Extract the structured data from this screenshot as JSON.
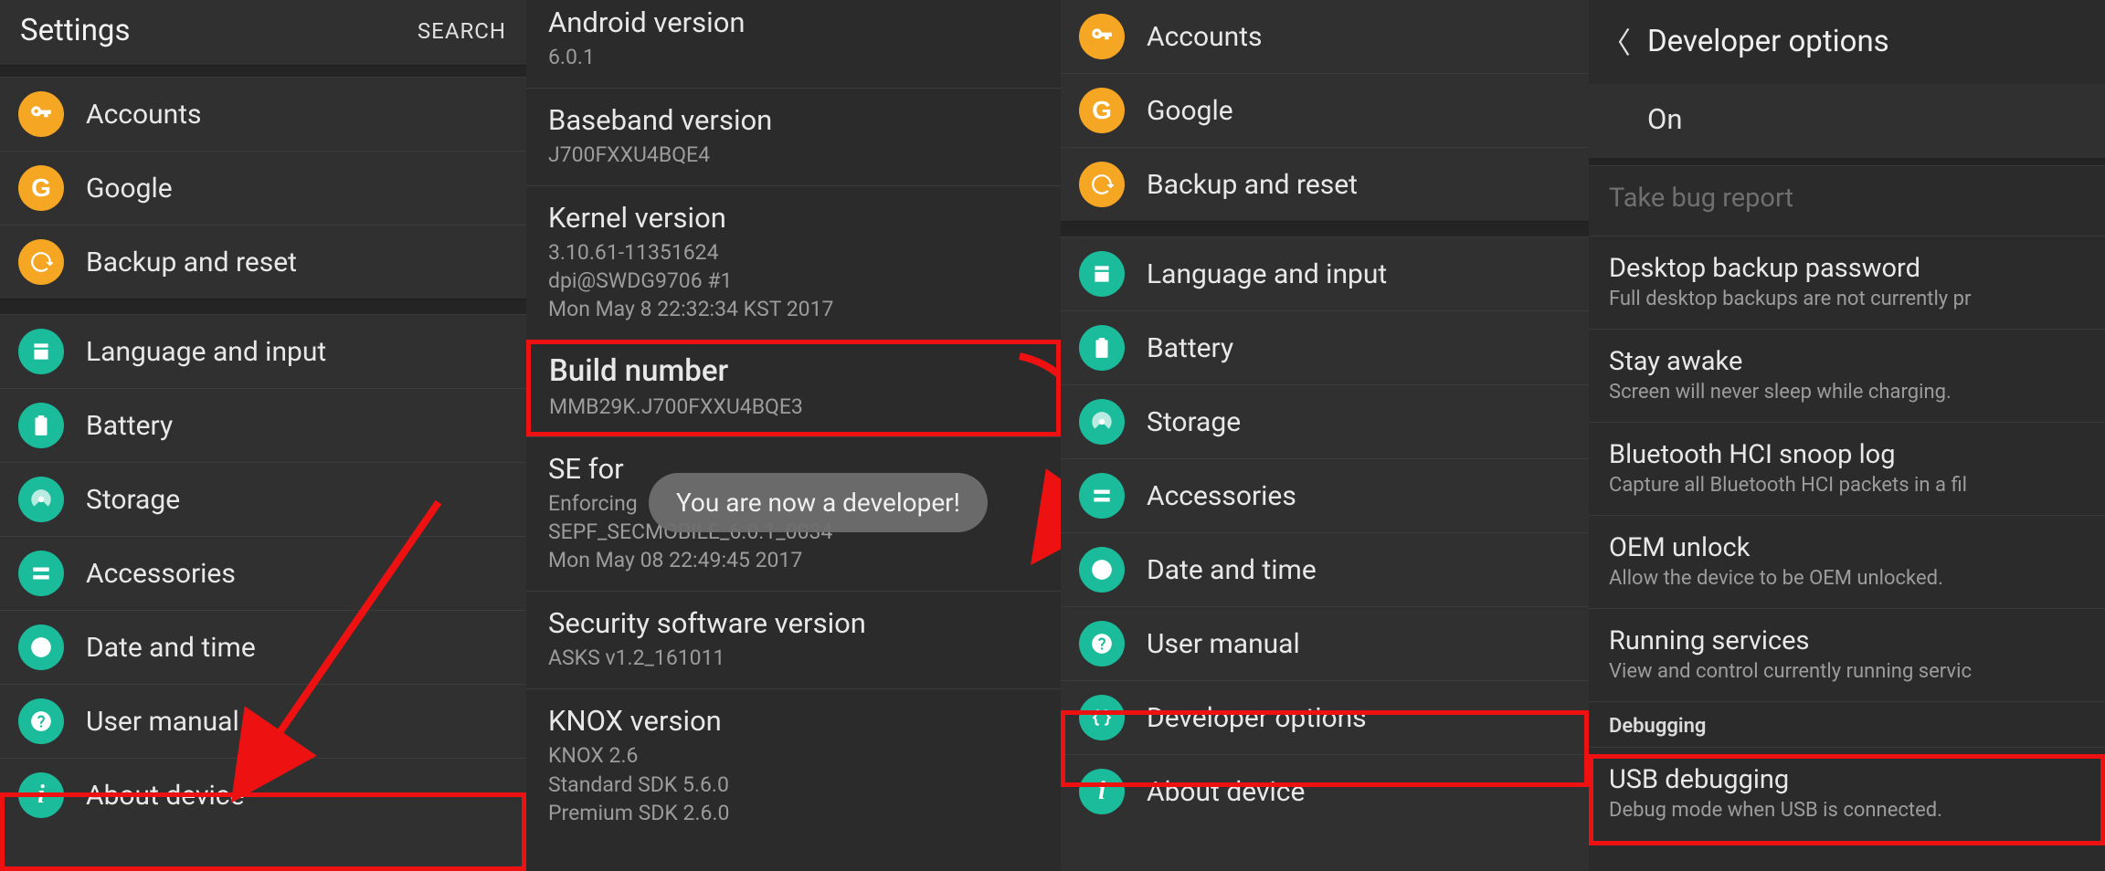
{
  "panel1": {
    "title": "Settings",
    "search": "SEARCH",
    "items": [
      {
        "label": "Accounts",
        "icon": "key-icon",
        "color": "ic-orange"
      },
      {
        "label": "Google",
        "icon": "google-icon",
        "color": "ic-google"
      },
      {
        "label": "Backup and reset",
        "icon": "backup-icon",
        "color": "ic-orange"
      }
    ],
    "items2": [
      {
        "label": "Language and input",
        "icon": "language-icon",
        "color": "ic-teal"
      },
      {
        "label": "Battery",
        "icon": "battery-icon",
        "color": "ic-teal"
      },
      {
        "label": "Storage",
        "icon": "storage-icon",
        "color": "ic-teal"
      },
      {
        "label": "Accessories",
        "icon": "accessories-icon",
        "color": "ic-teal"
      },
      {
        "label": "Date and time",
        "icon": "clock-icon",
        "color": "ic-teal"
      },
      {
        "label": "User manual",
        "icon": "help-icon",
        "color": "ic-teal"
      },
      {
        "label": "About device",
        "icon": "info-icon",
        "color": "ic-teal"
      }
    ]
  },
  "panel2": {
    "items": [
      {
        "title": "Android version",
        "sub": "6.0.1"
      },
      {
        "title": "Baseband version",
        "sub": "J700FXXU4BQE4"
      },
      {
        "title": "Kernel version",
        "sub": "3.10.61-11351624\ndpi@SWDG9706 #1\nMon May 8 22:32:34 KST 2017"
      },
      {
        "title": "Build number",
        "sub": "MMB29K.J700FXXU4BQE3",
        "highlight": true
      },
      {
        "title": "SE for ",
        "sub": "Enforcing\nSEPF_SECMOBILE_6.0.1_0034\nMon May 08 22:49:45 2017"
      },
      {
        "title": "Security software version",
        "sub": "ASKS v1.2_161011"
      },
      {
        "title": "KNOX version",
        "sub": "KNOX 2.6\nStandard SDK 5.6.0\nPremium SDK 2.6.0"
      }
    ],
    "toast": "You are now a developer!"
  },
  "panel3": {
    "items": [
      {
        "label": "Accounts",
        "icon": "key-icon",
        "color": "ic-orange"
      },
      {
        "label": "Google",
        "icon": "google-icon",
        "color": "ic-google"
      },
      {
        "label": "Backup and reset",
        "icon": "backup-icon",
        "color": "ic-orange"
      }
    ],
    "items2": [
      {
        "label": "Language and input",
        "icon": "language-icon",
        "color": "ic-teal"
      },
      {
        "label": "Battery",
        "icon": "battery-icon",
        "color": "ic-teal"
      },
      {
        "label": "Storage",
        "icon": "storage-icon",
        "color": "ic-teal"
      },
      {
        "label": "Accessories",
        "icon": "accessories-icon",
        "color": "ic-teal"
      },
      {
        "label": "Date and time",
        "icon": "clock-icon",
        "color": "ic-teal"
      },
      {
        "label": "User manual",
        "icon": "help-icon",
        "color": "ic-teal"
      },
      {
        "label": "Developer options",
        "icon": "braces-icon",
        "color": "ic-teal"
      },
      {
        "label": "About device",
        "icon": "info-icon",
        "color": "ic-teal"
      }
    ]
  },
  "panel4": {
    "title": "Developer options",
    "on": "On",
    "items": [
      {
        "title": "Take bug report",
        "sub": "",
        "disabled": true
      },
      {
        "title": "Desktop backup password",
        "sub": "Full desktop backups are not currently pr"
      },
      {
        "title": "Stay awake",
        "sub": "Screen will never sleep while charging."
      },
      {
        "title": "Bluetooth HCI snoop log",
        "sub": "Capture all Bluetooth HCI packets in a fil"
      },
      {
        "title": "OEM unlock",
        "sub": "Allow the device to be OEM unlocked."
      },
      {
        "title": "Running services",
        "sub": "View and control currently running servic"
      }
    ],
    "section": "Debugging",
    "usb": {
      "title": "USB debugging",
      "sub": "Debug mode when USB is connected."
    }
  }
}
